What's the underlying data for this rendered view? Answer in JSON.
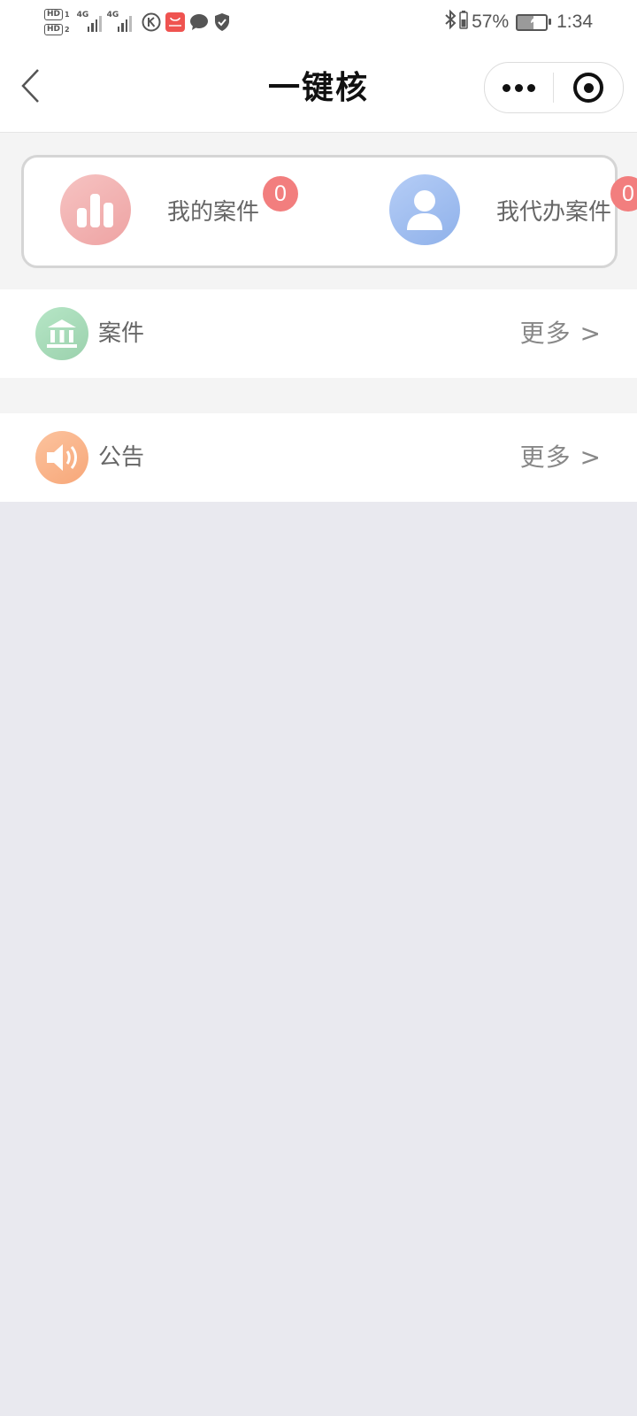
{
  "status_bar": {
    "hd1": "HD",
    "hd1_sub": "1",
    "hd2": "HD",
    "hd2_sub": "2",
    "network1": "4G",
    "network2": "4G",
    "battery_percent": "57%",
    "battery_level": 57,
    "time": "1:34",
    "icons": [
      "k-app-icon",
      "huawei-store-icon",
      "chat-bubble-icon",
      "shield-icon",
      "bluetooth-icon",
      "battery-icon",
      "power-saver-icon"
    ]
  },
  "nav": {
    "title": "一键核",
    "back_icon": "chevron-left-icon",
    "more_icon": "more-dots-icon",
    "close_icon": "target-close-icon"
  },
  "summary": {
    "my_cases": {
      "label": "我的案件",
      "count": "0",
      "icon": "bar-chart-icon"
    },
    "proxy_cases": {
      "label": "我代办案件",
      "count": "0",
      "icon": "user-icon"
    }
  },
  "sections": {
    "cases": {
      "title": "案件",
      "more": "更多 >",
      "icon": "bank-building-icon"
    },
    "notices": {
      "title": "公告",
      "more": "更多 >",
      "icon": "speaker-icon"
    }
  },
  "colors": {
    "badge": "#f27e7e",
    "card_border": "#d5d5d5",
    "page_background": "#e9e9ef",
    "icon_red": "#eea3a3",
    "icon_blue": "#8fb1ea",
    "icon_green": "#9bd1ad",
    "icon_orange": "#f7a779"
  }
}
